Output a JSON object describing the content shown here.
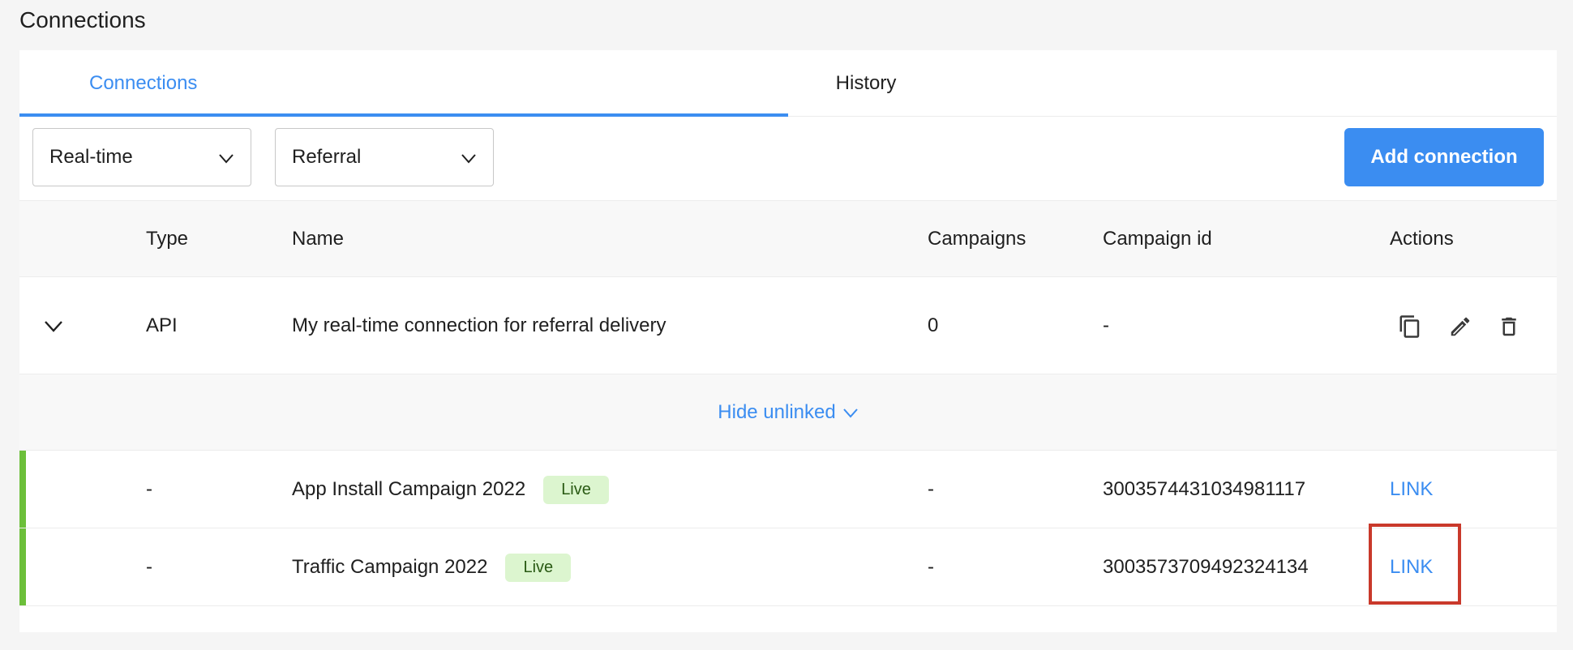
{
  "page": {
    "title": "Connections"
  },
  "tabs": [
    {
      "label": "Connections",
      "active": true
    },
    {
      "label": "History",
      "active": false
    }
  ],
  "filters": {
    "type": {
      "value": "Real-time"
    },
    "source": {
      "value": "Referral"
    }
  },
  "toolbar": {
    "add_label": "Add connection"
  },
  "table": {
    "headers": {
      "type": "Type",
      "name": "Name",
      "campaigns": "Campaigns",
      "campaign_id": "Campaign id",
      "actions": "Actions"
    },
    "connection": {
      "type": "API",
      "name": "My real-time connection for referral delivery",
      "campaigns": "0",
      "campaign_id": "-"
    },
    "hide_unlinked_label": "Hide unlinked",
    "campaigns": [
      {
        "type": "-",
        "name": "App Install Campaign 2022",
        "status": "Live",
        "campaigns": "-",
        "campaign_id": "3003574431034981117",
        "action": "LINK"
      },
      {
        "type": "-",
        "name": "Traffic Campaign 2022",
        "status": "Live",
        "campaigns": "-",
        "campaign_id": "3003573709492324134",
        "action": "LINK"
      }
    ]
  },
  "icons": {
    "expand": "chevron-down-icon",
    "copy": "copy-icon",
    "edit": "pencil-icon",
    "delete": "trash-icon"
  },
  "colors": {
    "accent": "#3b8df1",
    "live_badge_bg": "#dcf5cf",
    "linked_bar": "#6cbf3a",
    "highlight": "#c9392b"
  }
}
